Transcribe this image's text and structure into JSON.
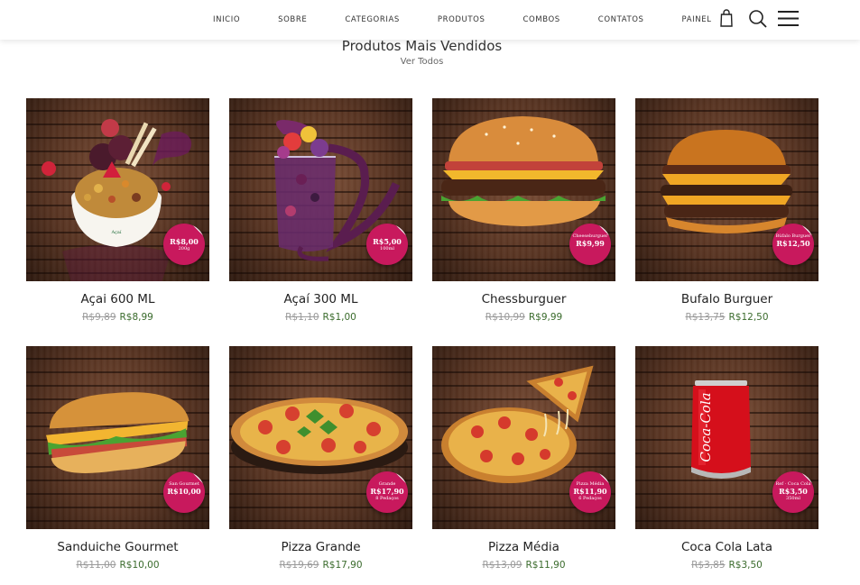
{
  "nav": {
    "items": [
      "INICIO",
      "SOBRE",
      "CATEGORIAS",
      "PRODUTOS",
      "COMBOS",
      "CONTATOS",
      "PAINEL"
    ],
    "icons": [
      "shopping-bag-icon",
      "search-icon",
      "menu-icon"
    ]
  },
  "section": {
    "title": "Produtos Mais Vendidos",
    "link": "Ver Todos"
  },
  "products": [
    {
      "name": "Açai 600 ML",
      "old_price": "R$9,89",
      "price": "R$8,99",
      "badge_label": "",
      "badge_price": "R$8,00",
      "badge_note": "200g"
    },
    {
      "name": "Açaí 300 ML",
      "old_price": "R$1,10",
      "price": "R$1,00",
      "badge_label": "",
      "badge_price": "R$5,00",
      "badge_note": "100ml"
    },
    {
      "name": "Chessburguer",
      "old_price": "R$10,99",
      "price": "R$9,99",
      "badge_label": "Cheeseburguer",
      "badge_price": "R$9,99",
      "badge_note": ""
    },
    {
      "name": "Bufalo Burguer",
      "old_price": "R$13,75",
      "price": "R$12,50",
      "badge_label": "Búfalo Burguer",
      "badge_price": "R$12,50",
      "badge_note": ""
    },
    {
      "name": "Sanduiche Gourmet",
      "old_price": "R$11,00",
      "price": "R$10,00",
      "badge_label": "San Gourmet",
      "badge_price": "R$10,00",
      "badge_note": ""
    },
    {
      "name": "Pizza Grande",
      "old_price": "R$19,69",
      "price": "R$17,90",
      "badge_label": "Grande",
      "badge_price": "R$17,90",
      "badge_note": "8 Pedaços"
    },
    {
      "name": "Pizza Média",
      "old_price": "R$13,09",
      "price": "R$11,90",
      "badge_label": "Pizza Média",
      "badge_price": "R$11,90",
      "badge_note": "6 Pedaços"
    },
    {
      "name": "Coca Cola Lata",
      "old_price": "R$3,85",
      "price": "R$3,50",
      "badge_label": "Ref · Coca Cola",
      "badge_price": "R$3,50",
      "badge_note": "350ml"
    }
  ],
  "colors": {
    "badge": "#c8195d",
    "sale_price": "#3a6b2c",
    "old_price": "#9a9a9a"
  }
}
